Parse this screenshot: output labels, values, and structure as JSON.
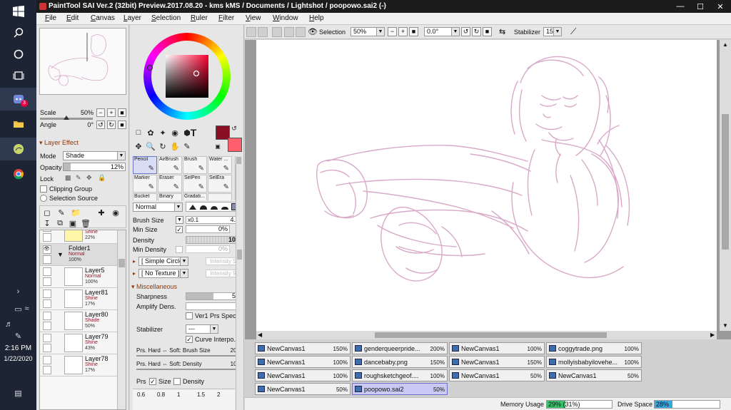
{
  "window": {
    "title": "PaintTool SAI Ver.2 (32bit) Preview.2017.08.20 - kms kMS / Documents / Lightshot / poopowo.sai2 (-)",
    "minimize": "—",
    "maximize": "☐",
    "close": "✕"
  },
  "menu": [
    "File",
    "Edit",
    "Canvas",
    "Layer",
    "Selection",
    "Ruler",
    "Filter",
    "View",
    "Window",
    "Help"
  ],
  "navigator": {
    "scale_label": "Scale",
    "scale_value": "50%",
    "scale_fraction": 0.5,
    "angle_label": "Angle",
    "angle_value": "0°"
  },
  "layer_effect": {
    "section": "Layer Effect",
    "mode_label": "Mode",
    "mode_value": "Shade",
    "opacity_label": "Opacity",
    "opacity_value": "12%",
    "opacity_fraction": 0.12,
    "lock_label": "Lock",
    "clipping_group": "Clipping Group",
    "selection_source": "Selection Source"
  },
  "layers": [
    {
      "name": "Layer88",
      "mode": "Shine",
      "opacity": "22%"
    },
    {
      "name": "Folder1",
      "mode": "Normal",
      "opacity": "100%",
      "folder": true
    },
    {
      "name": "Layer5",
      "mode": "Normal",
      "opacity": "100%"
    },
    {
      "name": "Layer81",
      "mode": "Shine",
      "opacity": "17%"
    },
    {
      "name": "Layer80",
      "mode": "Shade",
      "opacity": "50%"
    },
    {
      "name": "Layer79",
      "mode": "Shine",
      "opacity": "43%"
    },
    {
      "name": "Layer78",
      "mode": "Shine",
      "opacity": "17%"
    }
  ],
  "colors": {
    "primary": "#8a0f24",
    "secondary": "#ff5f6d",
    "sketch": "#d9a9c9",
    "accent_tab": "#c9c9f5"
  },
  "brushes": [
    {
      "name": "Pencil"
    },
    {
      "name": "AirBrush"
    },
    {
      "name": "Brush"
    },
    {
      "name": "Water ..."
    },
    {
      "name": "Marker"
    },
    {
      "name": "Eraser"
    },
    {
      "name": "SelPen"
    },
    {
      "name": "SelEra"
    },
    {
      "name": "Bucket"
    },
    {
      "name": "Binary"
    },
    {
      "name": "Gradati..."
    },
    {
      "name": ""
    }
  ],
  "brush_settings": {
    "blend_mode": "Normal",
    "brush_size_label": "Brush Size",
    "brush_size_mult": "x0.1",
    "brush_size_value": "4.0",
    "min_size_label": "Min Size",
    "min_size_value": "0%",
    "density_label": "Density",
    "density_value": "100",
    "min_density_label": "Min Density",
    "min_density_value": "0%",
    "shape_label": "[ Simple Circle ]",
    "shape_intensity": "Intensity 50",
    "texture_label": "[ No Texture ]",
    "texture_intensity": "Intensity 95",
    "misc_section": "Miscellaneous",
    "sharpness_label": "Sharpness",
    "sharpness_value": "50",
    "amplify_label": "Amplify Dens.",
    "amplify_value": "0",
    "ver1_label": "Ver1 Prs Spec.",
    "stabilizer_label": "Stabilizer",
    "stabilizer_value": "---",
    "curve_label": "Curve Interpo.",
    "prs_hard_size_label": "Prs. Hard ⇔ Soft: Brush Size",
    "prs_hard_size_value": "200",
    "prs_hard_density_label": "Prs. Hard ⇔ Soft: Density",
    "prs_hard_density_value": "100",
    "prs_label": "Prs",
    "size_label": "Size",
    "density_chk_label": "Density",
    "sizes": [
      "0.6",
      "0.8",
      "1",
      "1.5",
      "2"
    ]
  },
  "canvas_toolbar": {
    "selection_label": "Selection",
    "zoom": "50%",
    "angle": "0.0°",
    "stabilizer_label": "Stabilizer",
    "stabilizer_value": "15"
  },
  "documents": [
    {
      "name": "NewCanvas1",
      "zoom": "150%"
    },
    {
      "name": "genderqueerpride...",
      "zoom": "200%"
    },
    {
      "name": "NewCanvas1",
      "zoom": "100%"
    },
    {
      "name": "coggytrade.png",
      "zoom": "100%"
    },
    {
      "name": "NewCanvas1",
      "zoom": "100%"
    },
    {
      "name": "dancebaby.png",
      "zoom": "150%"
    },
    {
      "name": "NewCanvas1",
      "zoom": "150%"
    },
    {
      "name": "mollyisbabyilovehe...",
      "zoom": "100%"
    },
    {
      "name": "NewCanvas1",
      "zoom": "100%"
    },
    {
      "name": "roughsketchgeof....",
      "zoom": "100%"
    },
    {
      "name": "NewCanvas1",
      "zoom": "50%"
    },
    {
      "name": "NewCanvas1",
      "zoom": "50%"
    },
    {
      "name": "NewCanvas1",
      "zoom": "50%"
    },
    {
      "name": "poopowo.sai2",
      "zoom": "50%",
      "active": true
    }
  ],
  "status": {
    "memory_label": "Memory Usage",
    "memory_value": "29% (31%)",
    "memory_fraction": 0.29,
    "drive_label": "Drive Space",
    "drive_value": "28%",
    "drive_fraction": 0.28
  },
  "taskbar": {
    "time": "2:16 PM",
    "date": "1/22/2020",
    "chat_badge": "3"
  }
}
